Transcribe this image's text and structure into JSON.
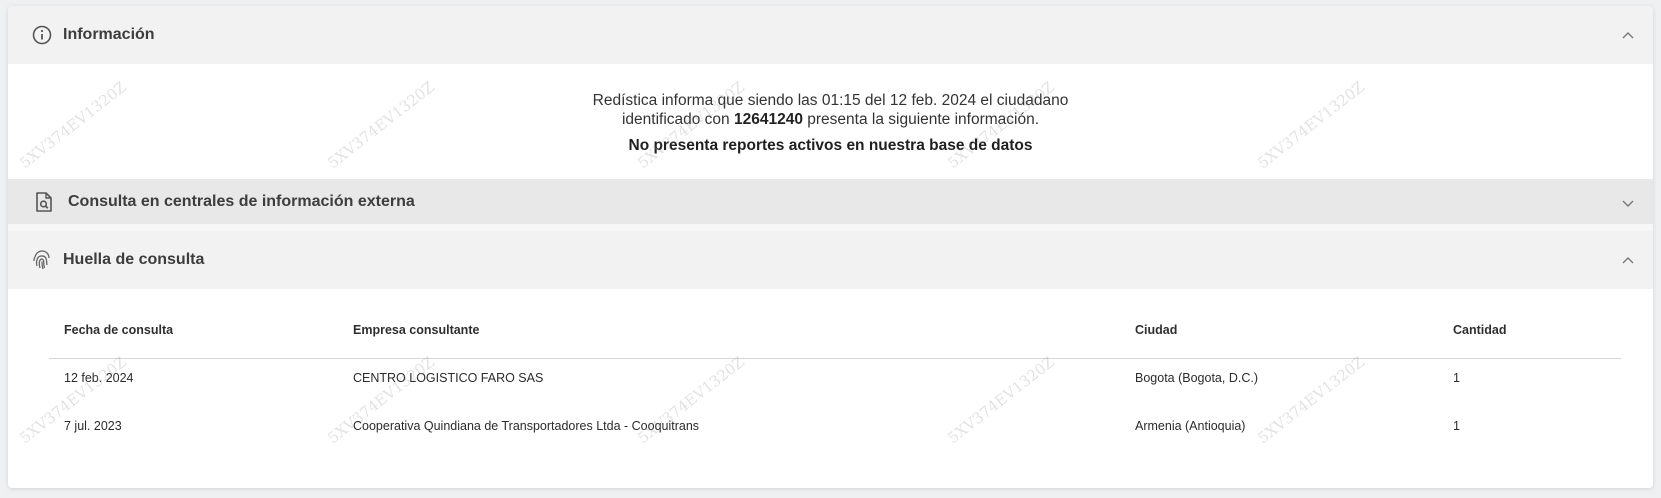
{
  "info": {
    "title": "Información",
    "line1": "Redística informa que siendo las 01:15 del 12 feb. 2024 el ciudadano",
    "line2_prefix": "identificado con ",
    "line2_id": "12641240",
    "line2_suffix": " presenta la siguiente información.",
    "strong": "No presenta reportes activos en nuestra base de datos"
  },
  "consulta": {
    "title": "Consulta en centrales de información externa"
  },
  "huella": {
    "title": "Huella de consulta",
    "headers": [
      "Fecha de consulta",
      "Empresa consultante",
      "Ciudad",
      "Cantidad"
    ],
    "rows": [
      [
        "12 feb. 2024",
        "CENTRO LOGISTICO FARO SAS",
        "Bogota (Bogota, D.C.)",
        "1"
      ],
      [
        "7 jul. 2023",
        "Cooperativa Quindiana de Transportadores Ltda - Cooquitrans",
        "Armenia (Antioquia)",
        "1"
      ]
    ]
  },
  "watermark": "5XV374EV1320Z",
  "icons": {
    "info": "info-circle-icon",
    "consulta": "document-search-icon",
    "huella": "fingerprint-icon",
    "expanded": "chevron-up-icon",
    "collapsed": "chevron-down-icon"
  }
}
